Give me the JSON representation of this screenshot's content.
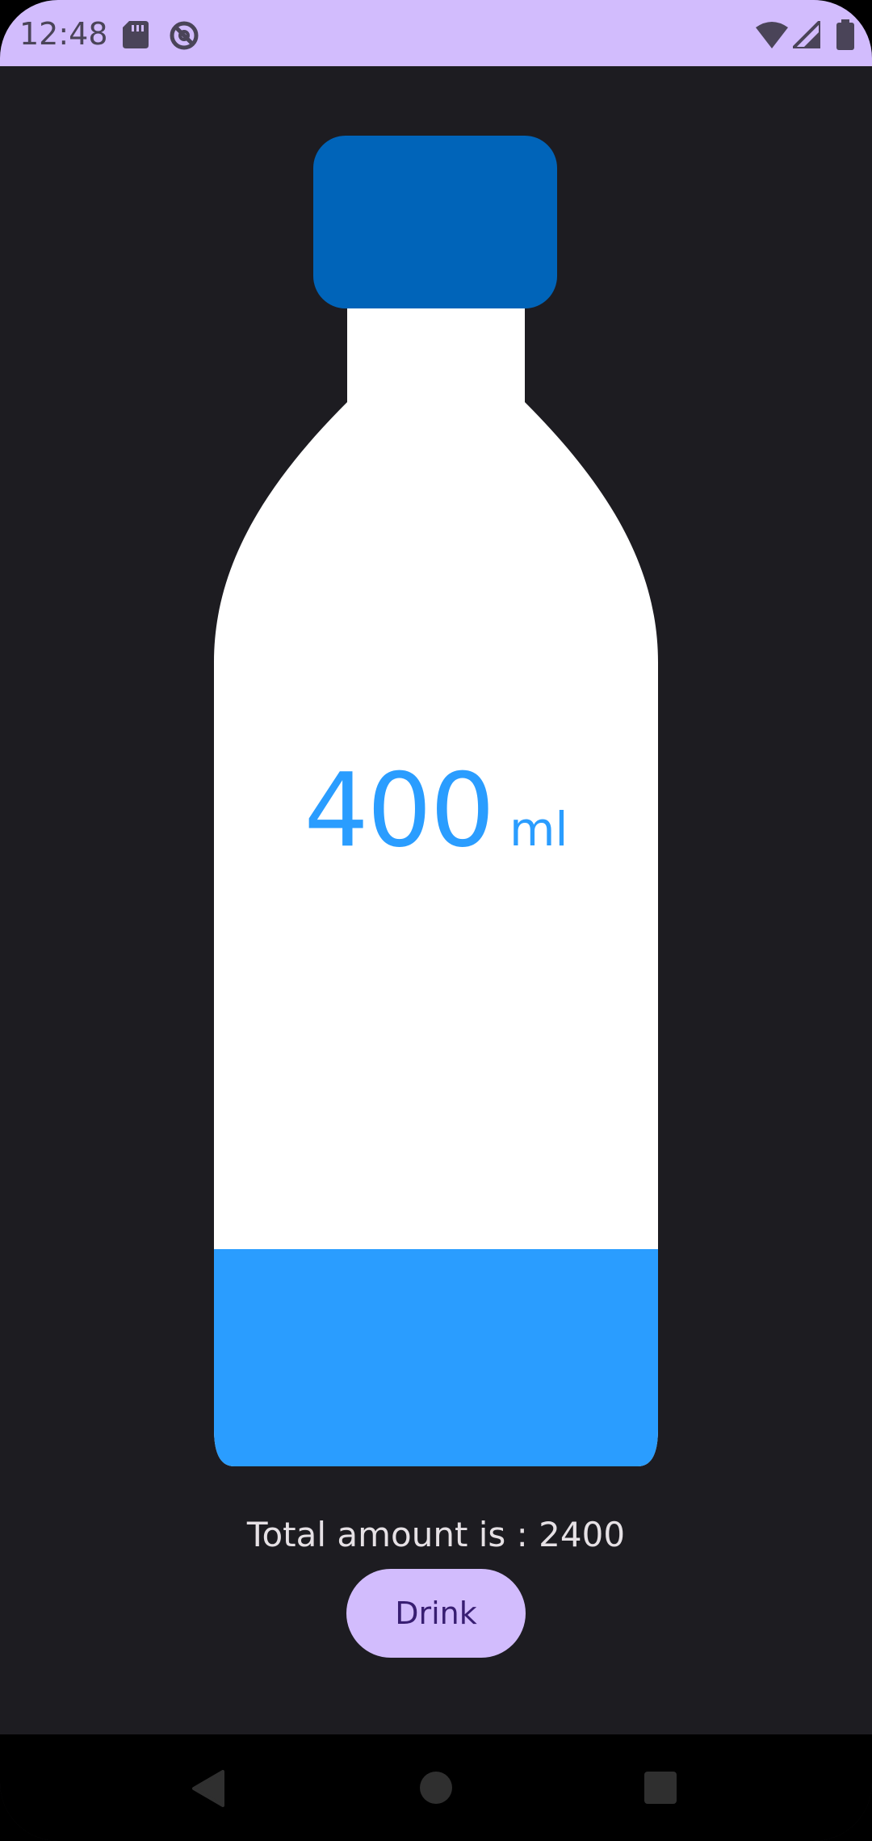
{
  "status_bar": {
    "time": "12:48",
    "icons": [
      "sd-card-icon",
      "do-not-disturb-icon",
      "wifi-icon",
      "cell-signal-icon",
      "battery-icon"
    ]
  },
  "bottle": {
    "current_amount": "400",
    "unit": "ml",
    "fill_fraction": 0.27
  },
  "total": {
    "text": "Total amount is : 2400"
  },
  "actions": {
    "drink_label": "Drink"
  },
  "navigation": {
    "icons": [
      "back-icon",
      "home-icon",
      "recents-icon"
    ]
  },
  "colors": {
    "accent": "#d2bcfd",
    "water": "#2a9dff",
    "cap": "#0064b9",
    "background": "#1d1c21"
  }
}
